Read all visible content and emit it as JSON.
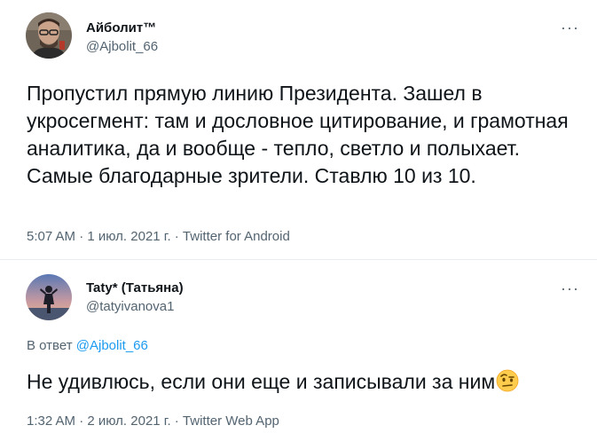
{
  "tweet1": {
    "display_name": "Айболит™",
    "handle": "@Ajbolit_66",
    "more_icon": "more-horizontal-icon",
    "text": "Пропустил прямую линию Президента. Зашел в укросегмент: там и дословное цитирование, и грамотная аналитика, да и вообще - тепло, светло и полыхает. Самые благодарные зрители. Ставлю 10 из 10.",
    "meta": "5:07 AM · 1 июл. 2021 г. · Twitter for Android"
  },
  "tweet2": {
    "display_name": "Taty* (Татьяна)",
    "handle": "@tatyivanova1",
    "more_icon": "more-horizontal-icon",
    "reply_prefix": "В ответ",
    "reply_mention": "@Ajbolit_66",
    "text": "Не удивлюсь, если они еще и записывали за ним",
    "emoji": "face-with-raised-eyebrow",
    "meta": "1:32 AM · 2 июл. 2021 г. · Twitter Web App"
  },
  "colors": {
    "text": "#0f1419",
    "secondary": "#536471",
    "link": "#1d9bf0",
    "divider": "#e6ecf0"
  }
}
